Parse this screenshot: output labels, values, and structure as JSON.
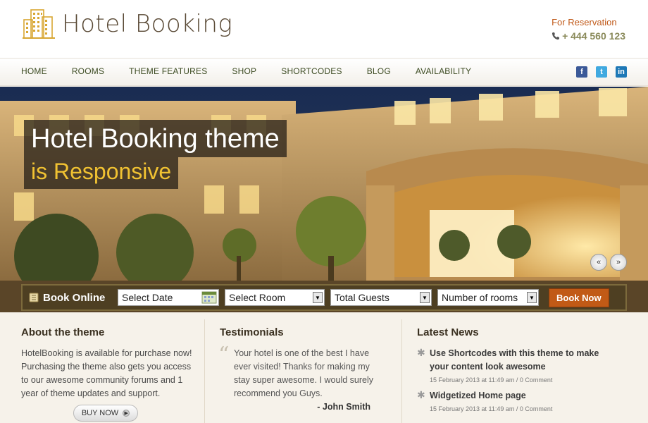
{
  "header": {
    "brand": "Hotel Booking",
    "reservation_label": "For Reservation",
    "phone": "+ 444 560 123",
    "icons": {
      "logo": "hotel-building-icon",
      "phone": "phone-icon"
    }
  },
  "nav": {
    "items": [
      {
        "label": "HOME"
      },
      {
        "label": "ROOMS"
      },
      {
        "label": "THEME FEATURES"
      },
      {
        "label": "SHOP"
      },
      {
        "label": "SHORTCODES"
      },
      {
        "label": "BLOG"
      },
      {
        "label": "AVAILABILITY"
      }
    ],
    "social": [
      "facebook-icon",
      "twitter-icon",
      "linkedin-icon"
    ]
  },
  "hero": {
    "title": "Hotel Booking theme",
    "subtitle": "is Responsive"
  },
  "booking": {
    "title": "Book Online",
    "date_value": "Select Date",
    "room_value": "Select Room",
    "guests_value": "Total Guests",
    "rooms_count_value": "Number of rooms",
    "submit_label": "Book Now"
  },
  "about": {
    "heading": "About the theme",
    "text": "HotelBooking is available for purchase now! Purchasing the theme also gets you access to our awesome community forums and 1 year of theme updates and support.",
    "button_label": "BUY NOW"
  },
  "testimonials": {
    "heading": "Testimonials",
    "quote": "Your hotel is one of the best I have ever visited! Thanks for making my stay super awesome. I would surely recommend you Guys.",
    "author": "- John Smith"
  },
  "news": {
    "heading": "Latest News",
    "items": [
      {
        "title": "Use Shortcodes with this theme to make your content look awesome",
        "date": "15 February 2013 at 11:49 am / 0 Comment"
      },
      {
        "title": "Widgetized Home page",
        "date": "15 February 2013 at 11:49 am / 0 Comment"
      }
    ]
  },
  "colors": {
    "accent_orange": "#c15a16",
    "caption_yellow": "#f1c232",
    "booking_bar": "#4e3f22"
  }
}
